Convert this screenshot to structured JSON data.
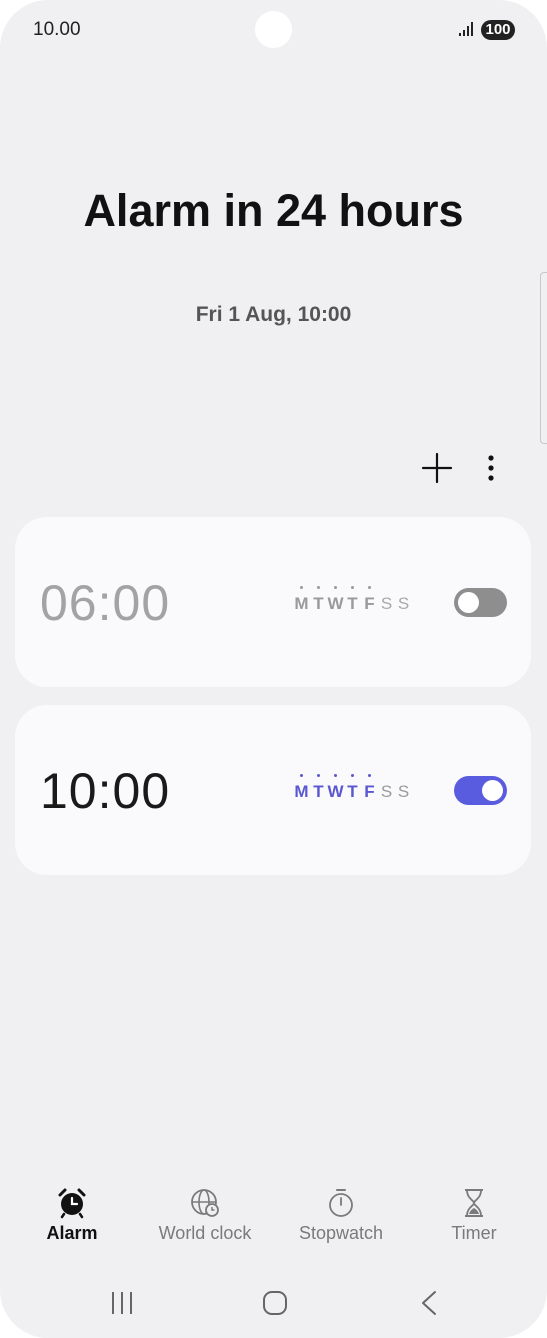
{
  "status_bar": {
    "time": "10.00",
    "battery": "100"
  },
  "header": {
    "title": "Alarm in 24 hours",
    "next_alarm": "Fri 1 Aug, 10:00"
  },
  "toolbar": {
    "add_icon": "plus-icon",
    "more_icon": "more-vertical-icon"
  },
  "alarms": [
    {
      "time": "06:00",
      "enabled": false,
      "days": [
        "M",
        "T",
        "W",
        "T",
        "F",
        "S",
        "S"
      ],
      "active_days": [
        true,
        true,
        true,
        true,
        true,
        false,
        false
      ]
    },
    {
      "time": "10:00",
      "enabled": true,
      "days": [
        "M",
        "T",
        "W",
        "T",
        "F",
        "S",
        "S"
      ],
      "active_days": [
        true,
        true,
        true,
        true,
        true,
        false,
        false
      ]
    }
  ],
  "colors": {
    "accent": "#5a5ce0",
    "toggle_off": "#8e8e8e",
    "background": "#f0f0f3",
    "card": "#fafafc"
  },
  "bottom_nav": {
    "active": "Alarm",
    "tabs": [
      {
        "label": "Alarm",
        "icon": "alarm-clock-icon"
      },
      {
        "label": "World clock",
        "icon": "globe-clock-icon"
      },
      {
        "label": "Stopwatch",
        "icon": "stopwatch-icon"
      },
      {
        "label": "Timer",
        "icon": "hourglass-icon"
      }
    ]
  },
  "system_nav": {
    "buttons": [
      "recents-icon",
      "home-icon",
      "back-icon"
    ]
  }
}
